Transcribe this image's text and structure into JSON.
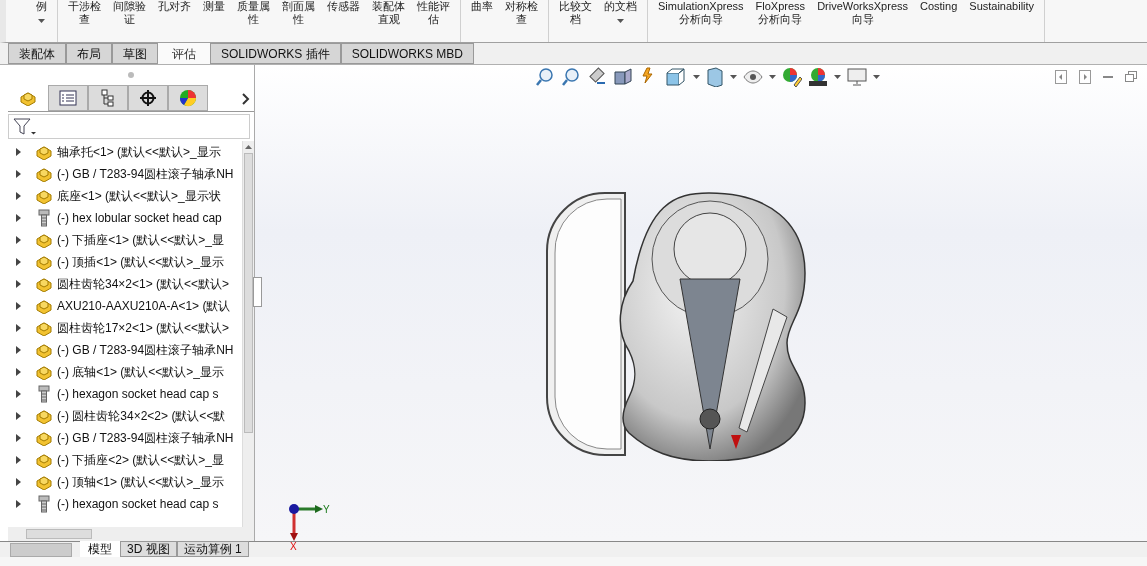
{
  "ribbon": {
    "groups": [
      {
        "items": [
          {
            "lines": [
              "例"
            ],
            "dropdown": true
          }
        ]
      },
      {
        "items": [
          {
            "lines": [
              "干涉检",
              "查"
            ],
            "dropdown": false
          },
          {
            "lines": [
              "间隙验",
              "证"
            ],
            "dropdown": false
          },
          {
            "lines": [
              "孔对齐"
            ],
            "dropdown": false
          },
          {
            "lines": [
              "测量"
            ],
            "dropdown": false
          },
          {
            "lines": [
              "质量属",
              "性"
            ],
            "dropdown": false
          },
          {
            "lines": [
              "剖面属",
              "性"
            ],
            "dropdown": false
          },
          {
            "lines": [
              "传感器"
            ],
            "dropdown": false
          },
          {
            "lines": [
              "装配体",
              "直观"
            ],
            "dropdown": false
          },
          {
            "lines": [
              "性能评",
              "估"
            ],
            "dropdown": false
          }
        ]
      },
      {
        "items": [
          {
            "lines": [
              "曲率"
            ],
            "dropdown": false
          },
          {
            "lines": [
              "对称检",
              "查"
            ],
            "dropdown": false
          }
        ]
      },
      {
        "items": [
          {
            "lines": [
              "比较文",
              "档"
            ],
            "dropdown": false
          },
          {
            "lines": [
              "的文档"
            ],
            "dropdown": true
          }
        ]
      },
      {
        "items": [
          {
            "lines": [
              "SimulationXpress",
              "分析向导"
            ],
            "dropdown": false
          },
          {
            "lines": [
              "FloXpress",
              "分析向导"
            ],
            "dropdown": false
          },
          {
            "lines": [
              "DriveWorksXpress",
              "向导"
            ],
            "dropdown": false
          },
          {
            "lines": [
              "Costing"
            ],
            "dropdown": false
          },
          {
            "lines": [
              "Sustainability"
            ],
            "dropdown": false
          }
        ]
      }
    ]
  },
  "tabs": [
    {
      "label": "装配体",
      "selected": false
    },
    {
      "label": "布局",
      "selected": false
    },
    {
      "label": "草图",
      "selected": false
    },
    {
      "label": "评估",
      "selected": true
    },
    {
      "label": "SOLIDWORKS 插件",
      "selected": false
    },
    {
      "label": "SOLIDWORKS MBD",
      "selected": false
    }
  ],
  "panel_tabs": [
    {
      "kind": "feature",
      "selected": true
    },
    {
      "kind": "property",
      "selected": false
    },
    {
      "kind": "config",
      "selected": false
    },
    {
      "kind": "dim",
      "selected": false
    },
    {
      "kind": "display",
      "selected": false
    }
  ],
  "tree": [
    {
      "kind": "part",
      "label": "轴承托<1> (默认<<默认>_显示"
    },
    {
      "kind": "part",
      "label": "(-) GB / T283-94圆柱滚子轴承NH"
    },
    {
      "kind": "part",
      "label": "底座<1> (默认<<默认>_显示状"
    },
    {
      "kind": "screw",
      "label": "(-) hex lobular socket head cap"
    },
    {
      "kind": "part",
      "label": "(-) 下插座<1> (默认<<默认>_显"
    },
    {
      "kind": "part",
      "label": "(-) 顶插<1> (默认<<默认>_显示"
    },
    {
      "kind": "part",
      "label": "圆柱齿轮34×2<1> (默认<<默认>"
    },
    {
      "kind": "part",
      "label": "AXU210-AAXU210A-A<1> (默认"
    },
    {
      "kind": "part",
      "label": "圆柱齿轮17×2<1> (默认<<默认>"
    },
    {
      "kind": "part",
      "label": "(-) GB / T283-94圆柱滚子轴承NH"
    },
    {
      "kind": "part",
      "label": "(-) 底轴<1> (默认<<默认>_显示"
    },
    {
      "kind": "screw",
      "label": "(-) hexagon socket head cap s"
    },
    {
      "kind": "part",
      "label": "(-) 圆柱齿轮34×2<2> (默认<<默"
    },
    {
      "kind": "part",
      "label": "(-) GB / T283-94圆柱滚子轴承NH"
    },
    {
      "kind": "part",
      "label": "(-) 下插座<2> (默认<<默认>_显"
    },
    {
      "kind": "part",
      "label": "(-) 顶轴<1> (默认<<默认>_显示"
    },
    {
      "kind": "screw",
      "label": "(-) hexagon socket head cap s"
    }
  ],
  "triad": {
    "y_label": "Y",
    "x_label": "X"
  },
  "bottom_tabs": [
    {
      "label": "模型",
      "selected": true
    },
    {
      "label": "3D 视图",
      "selected": false
    },
    {
      "label": "运动算例 1",
      "selected": false
    }
  ]
}
